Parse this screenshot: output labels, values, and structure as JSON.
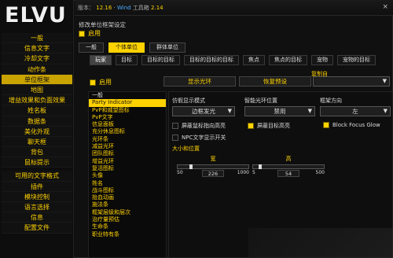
{
  "topbar": {
    "version_label": "版本：",
    "version": "12.16",
    "separator": "·",
    "addon": "Wind",
    "toolbox": "工具箱",
    "toolbox_version": "2.14",
    "close": "×"
  },
  "logo": {
    "text": "ELVU"
  },
  "rail": {
    "items": [
      "一般",
      "信息文字",
      "冷却文字",
      "动作条",
      "单位框架",
      "地图",
      "增益效果和负面效果",
      "姓名板",
      "数据条",
      "美化外观",
      "聊天框",
      "背包",
      "鼠标提示"
    ],
    "active_index": 4,
    "items2": [
      "可用的文字格式",
      "插件",
      "模块控制",
      "语言选择",
      "信息",
      "配置文件"
    ]
  },
  "header": {
    "section_title": "修改单位框架设定",
    "enable_label": "启用",
    "tabs": [
      "一般",
      "个体单位",
      "群体单位"
    ],
    "active_tab": 1
  },
  "unit_tabs": {
    "items": [
      "玩家",
      "目标",
      "目标的目标",
      "目标的目标的目标",
      "焦点",
      "焦点的目标",
      "宠物",
      "宠物的目标"
    ],
    "active_index": 0
  },
  "unit": {
    "enable_label": "启用",
    "show_aura_button": "显示光环",
    "reset_button": "恢复预设",
    "copy_from_label": "复制自",
    "copy_from_value": ""
  },
  "options_list": {
    "items": [
      "一般",
      "Party Indicator",
      "PvP和威望图标",
      "PvP文字",
      "信息面板",
      "充分休息图标",
      "光环条",
      "减益光环",
      "团队图标",
      "增益光环",
      "复活图标",
      "头像",
      "姓名",
      "战斗图标",
      "抬血动画",
      "施法条",
      "框架层级和层次",
      "治疗量预估",
      "生命条",
      "职业特有条"
    ],
    "selected_index": 1
  },
  "settings": {
    "glow_mode_label": "仿假显示模式",
    "glow_mode_value": "边框发光",
    "glow_pos_label": "智能光环位置",
    "glow_pos_value": "禁用",
    "frame_dir_label": "框架方向",
    "frame_dir_value": "左",
    "hide_mouseover_label": "屏蔽鼠标指向高亮",
    "hide_target_label": "屏蔽目标高亮",
    "block_focus_label": "Block Focus Glow",
    "npc_text_label": "NPC文字显示开关",
    "size_section": "大小和位置",
    "width_label": "宽",
    "width_min": "50",
    "width_value": "226",
    "width_max": "1000",
    "width_level": 0.186,
    "height_label": "高",
    "height_min": "5",
    "height_value": "54",
    "height_max": "500",
    "height_level": 0.099
  },
  "colors": {
    "accent": "#ffd200",
    "background": "#101010",
    "text": "#dddddd",
    "link_blue": "#49a9ff"
  }
}
